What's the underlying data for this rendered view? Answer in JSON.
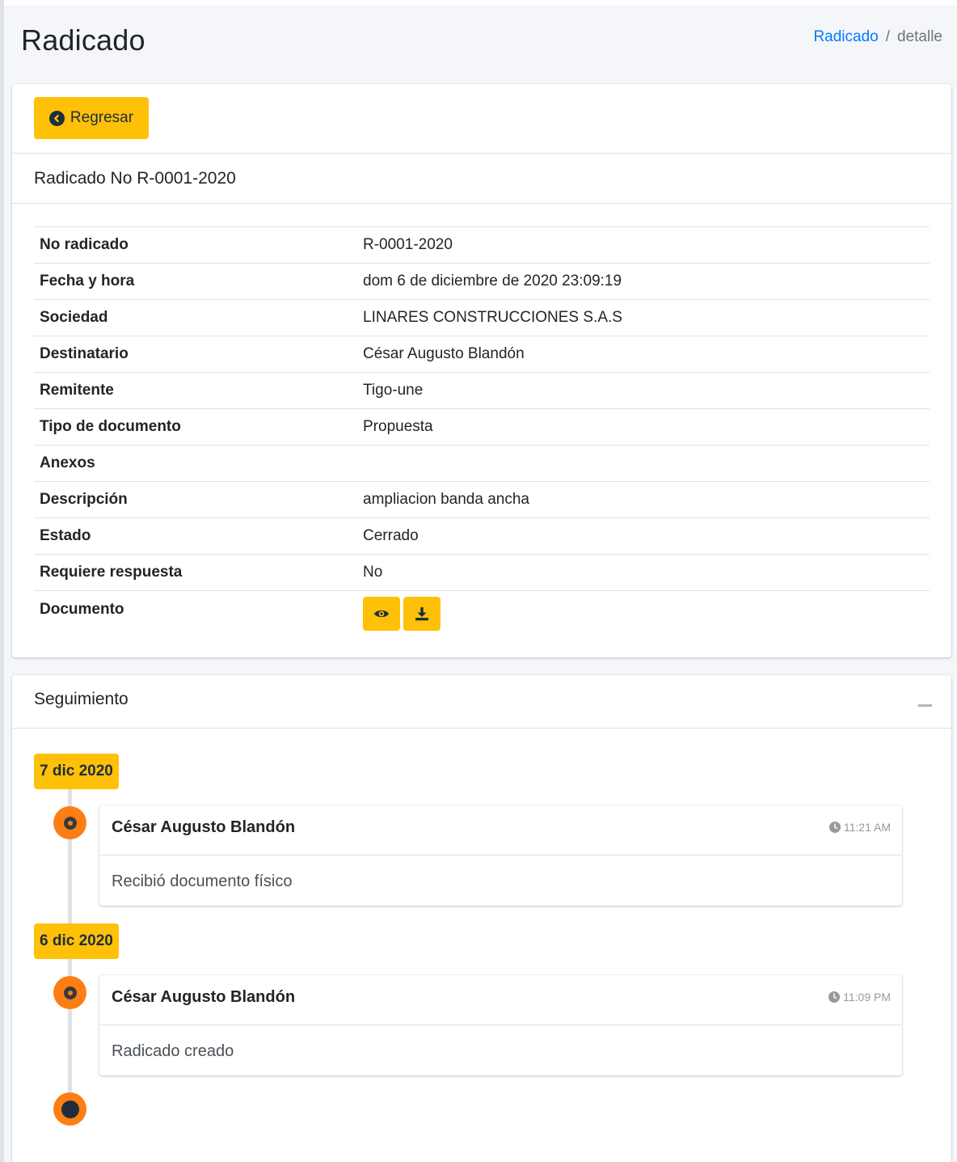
{
  "header": {
    "title": "Radicado",
    "breadcrumb": {
      "link": "Radicado",
      "separator": "/",
      "current": "detalle"
    }
  },
  "detail": {
    "back_label": "Regresar",
    "subtitle": "Radicado No R-0001-2020",
    "rows": [
      {
        "label": "No radicado",
        "value": "R-0001-2020"
      },
      {
        "label": "Fecha y hora",
        "value": "dom 6 de diciembre de 2020 23:09:19"
      },
      {
        "label": "Sociedad",
        "value": "LINARES CONSTRUCCIONES S.A.S"
      },
      {
        "label": "Destinatario",
        "value": "César Augusto Blandón"
      },
      {
        "label": "Remitente",
        "value": "Tigo-une"
      },
      {
        "label": "Tipo de documento",
        "value": "Propuesta"
      },
      {
        "label": "Anexos",
        "value": ""
      },
      {
        "label": "Descripción",
        "value": "ampliacion banda ancha"
      },
      {
        "label": "Estado",
        "value": "Cerrado"
      },
      {
        "label": "Requiere respuesta",
        "value": "No"
      }
    ],
    "document_label": "Documento",
    "document_actions": [
      "eye-icon",
      "download-icon"
    ]
  },
  "follow": {
    "title": "Seguimiento",
    "groups": [
      {
        "date": "7 dic 2020",
        "items": [
          {
            "author": "César Augusto Blandón",
            "time": "11:21 AM",
            "body": "Recibió documento físico"
          }
        ]
      },
      {
        "date": "6 dic 2020",
        "items": [
          {
            "author": "César Augusto Blandón",
            "time": "11:09 PM",
            "body": "Radicado creado"
          }
        ]
      }
    ]
  },
  "colors": {
    "accent": "#ffc107",
    "link": "#007bff",
    "timeline_dot": "#fd7e14"
  }
}
